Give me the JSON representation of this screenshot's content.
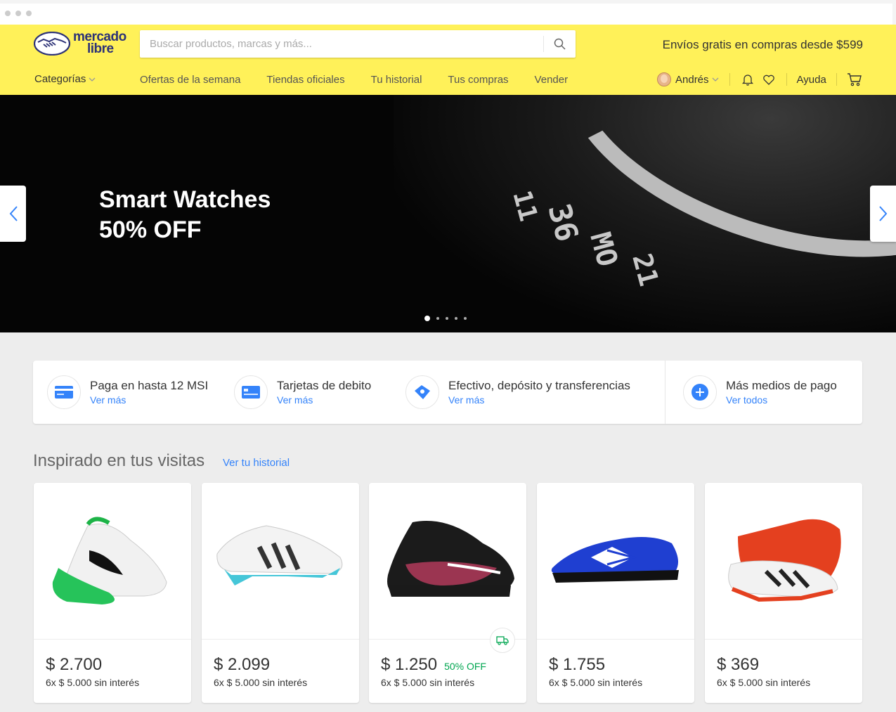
{
  "header": {
    "logo_line1": "mercado",
    "logo_line2": "libre",
    "search_placeholder": "Buscar productos, marcas y más...",
    "promo": "Envíos gratis en compras desde $599",
    "categories_label": "Categorías",
    "nav": [
      "Ofertas de la semana",
      "Tiendas oficiales",
      "Tu historial",
      "Tus compras",
      "Vender"
    ],
    "user_name": "Andrés",
    "help_label": "Ayuda",
    "accent_color": "#fff159"
  },
  "hero": {
    "title_line1": "Smart Watches",
    "title_line2": "50% OFF",
    "slides": 5,
    "active_slide": 1
  },
  "payments": [
    {
      "title": "Paga en hasta 12 MSI",
      "link": "Ver más",
      "icon": "credit-card-icon"
    },
    {
      "title": "Tarjetas de debito",
      "link": "Ver más",
      "icon": "debit-card-icon"
    },
    {
      "title": "Efectivo, depósito y transferencias",
      "link": "Ver más",
      "icon": "cash-icon"
    },
    {
      "title": "Más medios de pago",
      "link": "Ver todos",
      "icon": "plus-icon"
    }
  ],
  "section": {
    "title": "Inspirado en tus visitas",
    "link": "Ver tu historial"
  },
  "products": [
    {
      "price": "$ 2.700",
      "discount": "",
      "installments": "6x $ 5.000 sin interés"
    },
    {
      "price": "$ 2.099",
      "discount": "",
      "installments": "6x $ 5.000 sin interés"
    },
    {
      "price": "$ 1.250",
      "discount": "50% OFF",
      "installments": "6x $ 5.000 sin interés"
    },
    {
      "price": "$ 1.755",
      "discount": "",
      "installments": "6x $ 5.000 sin interés"
    },
    {
      "price": "$ 369",
      "discount": "",
      "installments": "6x $ 5.000 sin interés"
    }
  ]
}
